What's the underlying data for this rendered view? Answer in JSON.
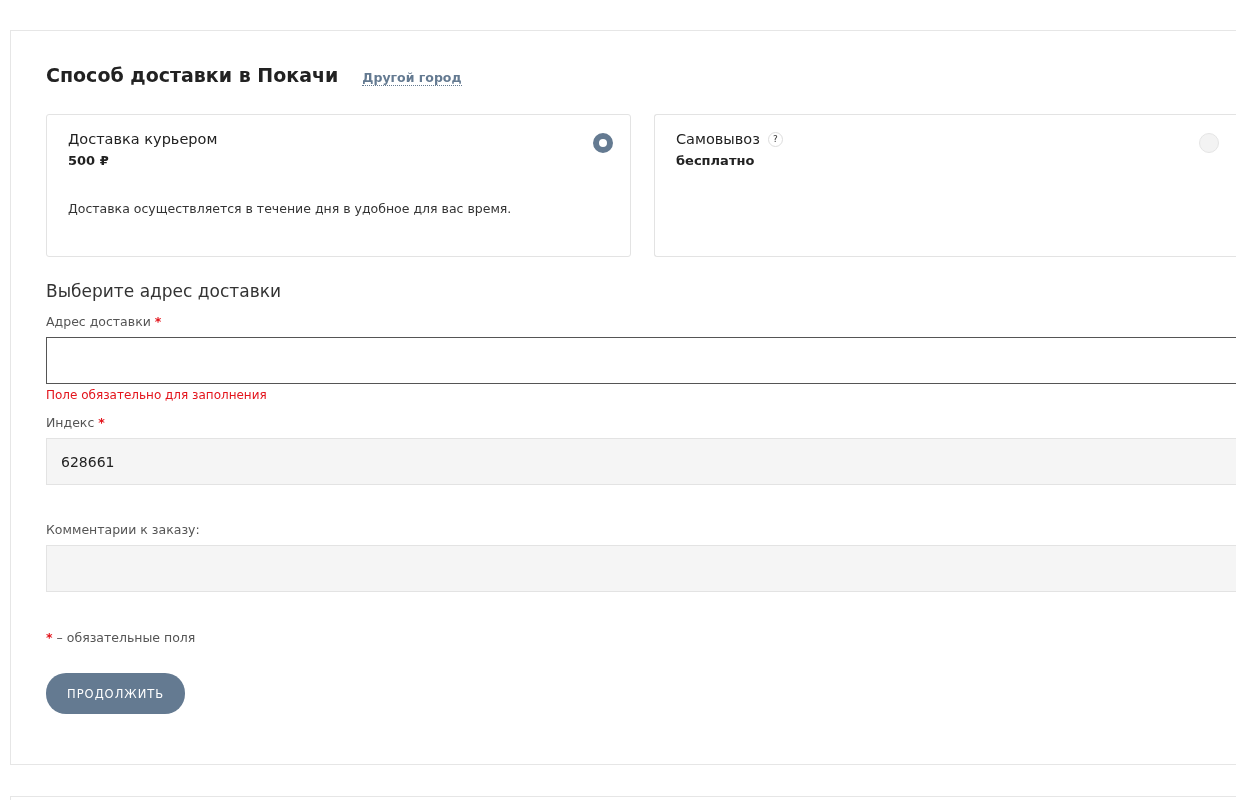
{
  "section": {
    "title": "Способ доставки в Покачи",
    "city_link": "Другой город"
  },
  "delivery_options": [
    {
      "name": "Доставка курьером",
      "price": "500 ₽",
      "description": "Доставка осуществляется в течение дня в удобное для вас время.",
      "selected": true
    },
    {
      "name": "Самовывоз",
      "help": "?",
      "price": "бесплатно",
      "selected": false
    }
  ],
  "address_heading": "Выберите адрес доставки",
  "fields": [
    {
      "kind": "input",
      "label": "Адрес доставки",
      "required_mark": "*",
      "error": "Поле обязательно для заполнения",
      "invalid": true
    },
    {
      "kind": "input",
      "label": "Индекс",
      "required_mark": "*",
      "value": "628661",
      "invalid": false
    },
    {
      "kind": "textarea",
      "label": "Комментарии к заказу:",
      "invalid": false
    }
  ],
  "required_note": {
    "mark": "*",
    "text": "– обязательные поля"
  },
  "submit_button": "ПРОДОЛЖИТЬ"
}
